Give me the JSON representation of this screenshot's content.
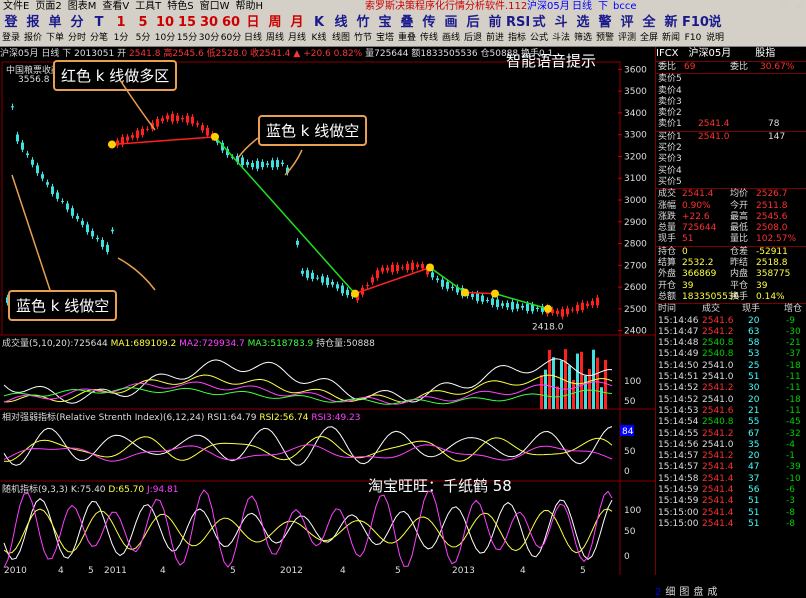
{
  "menu": [
    "文件E",
    "页面2",
    "图表M",
    "查看V",
    "工具T",
    "特色S",
    "窗口W",
    "帮助H"
  ],
  "app_title": "索罗斯决策程序化行情分析软件.112",
  "symbol_bar": {
    "name": "沪深05月",
    "period": "日线",
    "nav": "下",
    "code": "bcce"
  },
  "toolbar": {
    "tools": [
      {
        "icon": "登",
        "label": "登录"
      },
      {
        "icon": "报",
        "label": "报价"
      },
      {
        "icon": "单",
        "label": "下单"
      },
      {
        "icon": "分",
        "label": "分时"
      },
      {
        "icon": "T",
        "label": "分笔"
      },
      {
        "icon": "1",
        "label": "1分"
      },
      {
        "icon": "5",
        "label": "5分"
      },
      {
        "icon": "10",
        "label": "10分"
      },
      {
        "icon": "15",
        "label": "15分"
      },
      {
        "icon": "30",
        "label": "30分"
      },
      {
        "icon": "60",
        "label": "60分"
      },
      {
        "icon": "日",
        "label": "日线"
      },
      {
        "icon": "周",
        "label": "周线"
      },
      {
        "icon": "月",
        "label": "月线"
      },
      {
        "icon": "K",
        "label": "K线"
      },
      {
        "icon": "线",
        "label": "线图"
      },
      {
        "icon": "竹",
        "label": "竹节"
      },
      {
        "icon": "宝",
        "label": "宝塔"
      },
      {
        "icon": "叠",
        "label": "重叠"
      },
      {
        "icon": "传",
        "label": "传线"
      },
      {
        "icon": "画",
        "label": "画线"
      },
      {
        "icon": "后",
        "label": "后退"
      },
      {
        "icon": "前",
        "label": "前进"
      },
      {
        "icon": "RSI",
        "label": "指标"
      },
      {
        "icon": "式",
        "label": "公式"
      },
      {
        "icon": "斗",
        "label": "斗法"
      },
      {
        "icon": "选",
        "label": "筛选"
      },
      {
        "icon": "警",
        "label": "预警"
      },
      {
        "icon": "评",
        "label": "评测"
      },
      {
        "icon": "全",
        "label": "全屏"
      },
      {
        "icon": "新",
        "label": "新闻"
      },
      {
        "icon": "F10",
        "label": "F10"
      },
      {
        "icon": "说",
        "label": "说明"
      }
    ]
  },
  "infobar": {
    "name": "沪深05月",
    "period": "日线",
    "nav": "下",
    "date": "2013051",
    "open_label": "开",
    "prices": "2541.8 高2545.6 低2528.0 收2541.4 ▲",
    "change": "+20.6",
    "pct": "0.82%",
    "vol": "量725644",
    "amt": "额1833505536",
    "oi": "仓50888",
    "turn": "换手0.1"
  },
  "chart_data": {
    "type": "candlestick",
    "title": "中国粮票收藏行情分析软件-开发者",
    "price_axis": [
      "3600",
      "3500",
      "3400",
      "3300",
      "3200",
      "3100",
      "3000",
      "2900",
      "2800",
      "2700",
      "2600",
      "2500",
      "2400"
    ],
    "price_range": [
      2380,
      3620
    ],
    "max_label": "3556.8",
    "min_label": "2418.0",
    "x_labels": [
      "2010",
      "4",
      "5",
      "2011",
      "4",
      "5",
      "2012",
      "4",
      "5",
      "2013",
      "4",
      "5"
    ],
    "volume_panel": {
      "label": "成交量",
      "params": "(5,10,20)",
      "value": ":725644",
      "ma1": "MA1:689109.2",
      "ma2": "MA2:729934.7",
      "ma3": "MA3:518783.9",
      "oi": "持仓量",
      "oi_val": ":50888",
      "axis": [
        "100",
        "50"
      ]
    },
    "rsi_panel": {
      "label": "相对强弱指标(Relative Strenth Index)",
      "params": "(6,12,24)",
      "rsi1": "RSI1:64.79",
      "rsi2": "RSI2:56.74",
      "rsi3": "RSI3:49.23",
      "axis": [
        "50",
        "0"
      ],
      "badge": "84"
    },
    "kdj_panel": {
      "label": "随机指标",
      "params": "(9,3,3)",
      "k": "K:75.40",
      "d": "D:65.70",
      "j": "J:94.81",
      "axis": [
        "100",
        "50",
        "0"
      ]
    }
  },
  "annotations": {
    "red_long": "红色 k 线做多区",
    "blue_short_top": "蓝色 k 线做空",
    "blue_short_left": "蓝色 k 线做空",
    "voice": "智能语音提示",
    "shop": "淘宝旺旺：千纸鹤 58"
  },
  "quote_panel": {
    "code": "IFCX",
    "name": "沪深05月",
    "tab": "股指",
    "header": {
      "wb_label": "委比",
      "wb_val": "69",
      "wr_label": "委比",
      "wr_val": "30.67%"
    },
    "asks": [
      {
        "label": "卖价5",
        "price": "",
        "vol": ""
      },
      {
        "label": "卖价4",
        "price": "",
        "vol": ""
      },
      {
        "label": "卖价3",
        "price": "",
        "vol": ""
      },
      {
        "label": "卖价2",
        "price": "",
        "vol": ""
      },
      {
        "label": "卖价1",
        "price": "2541.4",
        "vol": "78"
      }
    ],
    "bids": [
      {
        "label": "买价1",
        "price": "2541.0",
        "vol": "147"
      },
      {
        "label": "买价2",
        "price": "",
        "vol": ""
      },
      {
        "label": "买价3",
        "price": "",
        "vol": ""
      },
      {
        "label": "买价4",
        "price": "",
        "vol": ""
      },
      {
        "label": "买价5",
        "price": "",
        "vol": ""
      }
    ],
    "stats": [
      {
        "l1": "成交",
        "v1": "2541.4",
        "l2": "均价",
        "v2": "2526.7"
      },
      {
        "l1": "涨幅",
        "v1": "0.90%",
        "l2": "今开",
        "v2": "2511.8"
      },
      {
        "l1": "涨跌",
        "v1": "+22.6",
        "l2": "最高",
        "v2": "2545.6"
      },
      {
        "l1": "总量",
        "v1": "725644",
        "l2": "最低",
        "v2": "2508.0"
      },
      {
        "l1": "现手",
        "v1": "51",
        "l2": "量比",
        "v2": "102.57%"
      }
    ],
    "stats2": [
      {
        "l1": "持仓",
        "v1": "0",
        "l2": "仓差",
        "v2": "-52911"
      },
      {
        "l1": "结算",
        "v1": "2532.2",
        "l2": "昨结",
        "v2": "2518.8"
      },
      {
        "l1": "外盘",
        "v1": "366869",
        "l2": "内盘",
        "v2": "358775"
      },
      {
        "l1": "开仓",
        "v1": "39",
        "l2": "平仓",
        "v2": "39"
      },
      {
        "l1": "总额",
        "v1": "1833505536",
        "l2": "换手",
        "v2": "0.14%"
      }
    ],
    "ticks_header": {
      "time": "时间",
      "price": "成交",
      "vol": "现手",
      "chg": "增仓"
    },
    "ticks": [
      {
        "time": "15:14:46",
        "price": "2541.6",
        "vol": "20",
        "chg": "-9"
      },
      {
        "time": "15:14:47",
        "price": "2541.2",
        "vol": "63",
        "chg": "-30"
      },
      {
        "time": "15:14:48",
        "price": "2540.8",
        "vol": "58",
        "chg": "-21"
      },
      {
        "time": "15:14:49",
        "price": "2540.8",
        "vol": "53",
        "chg": "-37"
      },
      {
        "time": "15:14:50",
        "price": "2541.0",
        "vol": "25",
        "chg": "-18"
      },
      {
        "time": "15:14:51",
        "price": "2541.0",
        "vol": "51",
        "chg": "-11"
      },
      {
        "time": "15:14:52",
        "price": "2541.2",
        "vol": "30",
        "chg": "-11"
      },
      {
        "time": "15:14:52",
        "price": "2541.0",
        "vol": "20",
        "chg": "-18"
      },
      {
        "time": "15:14:53",
        "price": "2541.6",
        "vol": "21",
        "chg": "-11"
      },
      {
        "time": "15:14:54",
        "price": "2540.8",
        "vol": "55",
        "chg": "-45"
      },
      {
        "time": "15:14:55",
        "price": "2541.2",
        "vol": "67",
        "chg": "-32"
      },
      {
        "time": "15:14:56",
        "price": "2541.0",
        "vol": "35",
        "chg": "-4"
      },
      {
        "time": "15:14:57",
        "price": "2541.2",
        "vol": "20",
        "chg": "-1"
      },
      {
        "time": "15:14:57",
        "price": "2541.4",
        "vol": "47",
        "chg": "-39"
      },
      {
        "time": "15:14:58",
        "price": "2541.4",
        "vol": "37",
        "chg": "-10"
      },
      {
        "time": "15:14:59",
        "price": "2541.4",
        "vol": "56",
        "chg": "-6"
      },
      {
        "time": "15:14:59",
        "price": "2541.4",
        "vol": "51",
        "chg": "-3"
      },
      {
        "time": "15:15:00",
        "price": "2541.4",
        "vol": "51",
        "chg": "-8"
      },
      {
        "time": "15:15:00",
        "price": "2541.4",
        "vol": "51",
        "chg": "-8"
      }
    ],
    "bottom_tabs": [
      "2",
      "细",
      "图",
      "盘",
      "成"
    ]
  }
}
